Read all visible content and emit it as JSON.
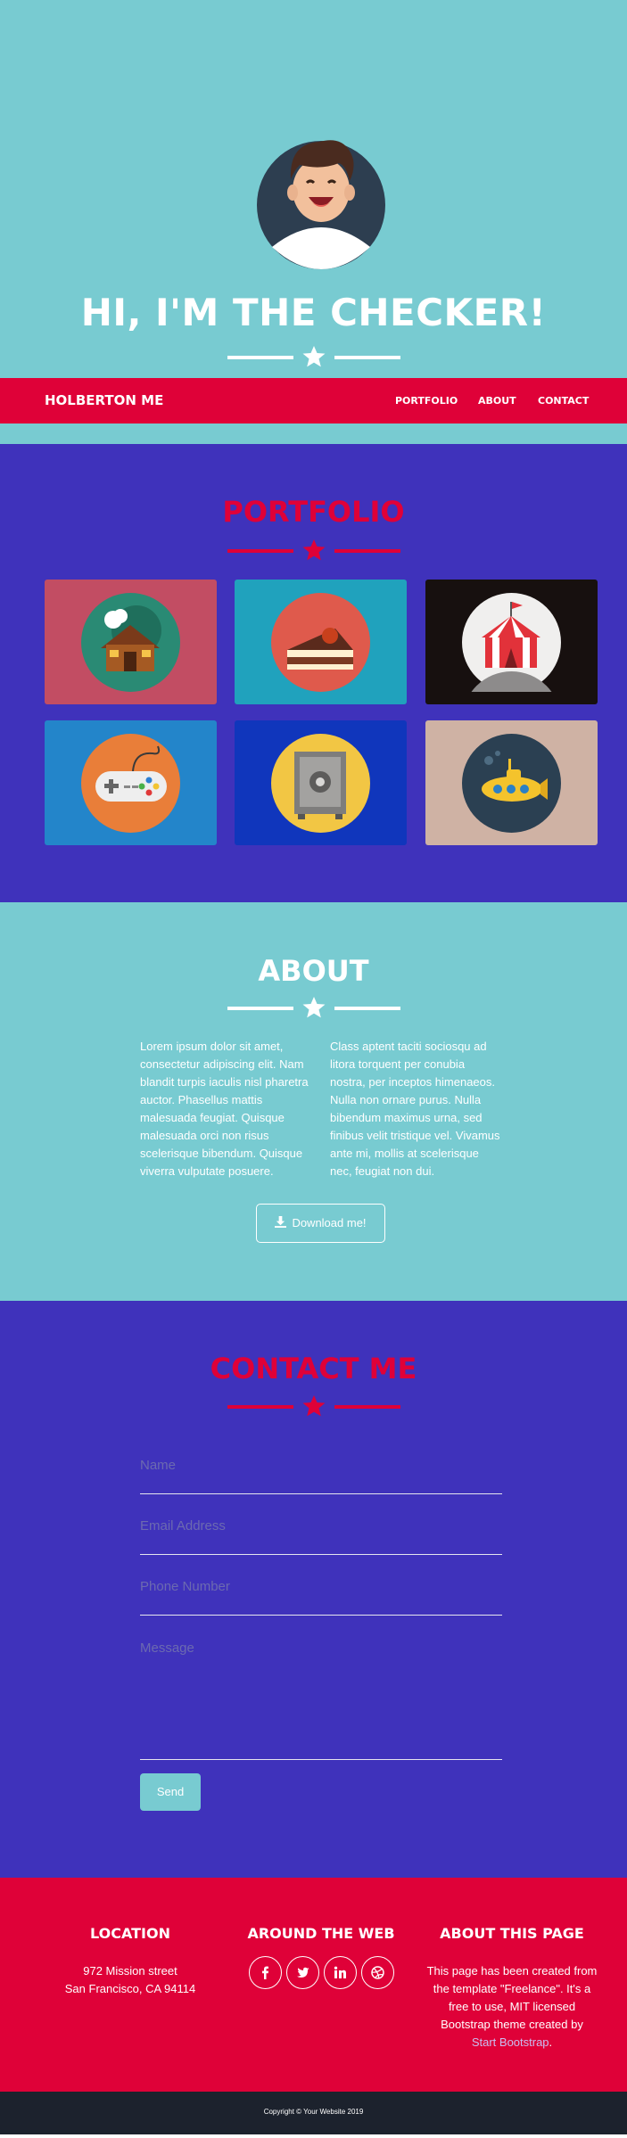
{
  "header": {
    "title": "HI, I'M THE CHECKER!",
    "avatar_icon": "avatar-icon",
    "divider_icon": "star-icon"
  },
  "nav": {
    "brand": "HOLBERTON ME",
    "links": [
      "PORTFOLIO",
      "ABOUT",
      "CONTACT"
    ]
  },
  "portfolio": {
    "title": "PORTFOLIO",
    "items": [
      {
        "icon": "cabin-icon",
        "bg": "#c24d63"
      },
      {
        "icon": "cake-icon",
        "bg": "#20a2bd"
      },
      {
        "icon": "circus-tent-icon",
        "bg": "#17100f"
      },
      {
        "icon": "game-controller-icon",
        "bg": "#2385ca"
      },
      {
        "icon": "safe-icon",
        "bg": "#1036bc"
      },
      {
        "icon": "submarine-icon",
        "bg": "#cfb2a4"
      }
    ]
  },
  "about": {
    "title": "ABOUT",
    "col1": "Lorem ipsum dolor sit amet, consectetur adipiscing elit. Nam blandit turpis iaculis nisl pharetra auctor. Phasellus mattis malesuada feugiat. Quisque malesuada orci non risus scelerisque bibendum. Quisque viverra vulputate posuere.",
    "col2": "Class aptent taciti sociosqu ad litora torquent per conubia nostra, per inceptos himenaeos. Nulla non ornare purus. Nulla bibendum maximus urna, sed finibus velit tristique vel. Vivamus ante mi, mollis at scelerisque nec, feugiat non dui.",
    "download_label": "Download me!",
    "download_icon": "download-icon"
  },
  "contact": {
    "title": "CONTACT ME",
    "name_placeholder": "Name",
    "email_placeholder": "Email Address",
    "phone_placeholder": "Phone Number",
    "message_placeholder": "Message",
    "send_label": "Send"
  },
  "footer": {
    "location_heading": "LOCATION",
    "address_line1": "972 Mission street",
    "address_line2": "San Francisco, CA 94114",
    "web_heading": "AROUND THE WEB",
    "social_icons": [
      "facebook-icon",
      "twitter-icon",
      "linkedin-icon",
      "dribbble-icon"
    ],
    "about_heading": "ABOUT THIS PAGE",
    "about_line1": "This page has been created from",
    "about_line2": "the template \"Freelance\". It's a",
    "about_line3": "free to use, MIT licensed",
    "about_line4": "Bootstrap theme created by",
    "about_link": "Start Bootstrap",
    "about_end": "."
  },
  "copyright": "Copyright © Your Website 2019",
  "colors": {
    "teal": "#78cbd1",
    "purple": "#3f32bb",
    "red": "#df0138",
    "dark": "#1c222d"
  }
}
